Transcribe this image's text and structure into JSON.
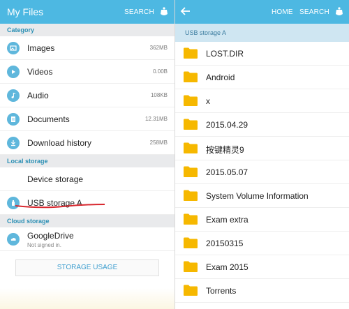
{
  "left": {
    "title": "My Files",
    "search_label": "SEARCH",
    "category_header": "Category",
    "categories": [
      {
        "label": "Images",
        "size": "362MB",
        "icon": "image-icon"
      },
      {
        "label": "Videos",
        "size": "0.00B",
        "icon": "video-icon"
      },
      {
        "label": "Audio",
        "size": "108KB",
        "icon": "music-icon"
      },
      {
        "label": "Documents",
        "size": "12.31MB",
        "icon": "document-icon"
      },
      {
        "label": "Download history",
        "size": "258MB",
        "icon": "download-icon"
      }
    ],
    "local_header": "Local storage",
    "local": [
      {
        "label": "Device storage"
      },
      {
        "label": "USB storage A",
        "icon": "usb-icon"
      }
    ],
    "cloud_header": "Cloud storage",
    "cloud": {
      "label": "GoogleDrive",
      "sub": "Not signed in.",
      "icon": "cloud-icon"
    },
    "usage_label": "STORAGE USAGE"
  },
  "right": {
    "home_label": "HOME",
    "search_label": "SEARCH",
    "path": "USB storage A",
    "folders": [
      "LOST.DIR",
      "Android",
      "x",
      "2015.04.29",
      "按键精灵9",
      "2015.05.07",
      "System Volume Information",
      "Exam extra",
      "20150315",
      "Exam 2015",
      "Torrents"
    ]
  },
  "colors": {
    "appbar": "#4db8e2",
    "accent": "#2a8fb4",
    "folder": "#f6b800",
    "underline": "#d8282f"
  }
}
